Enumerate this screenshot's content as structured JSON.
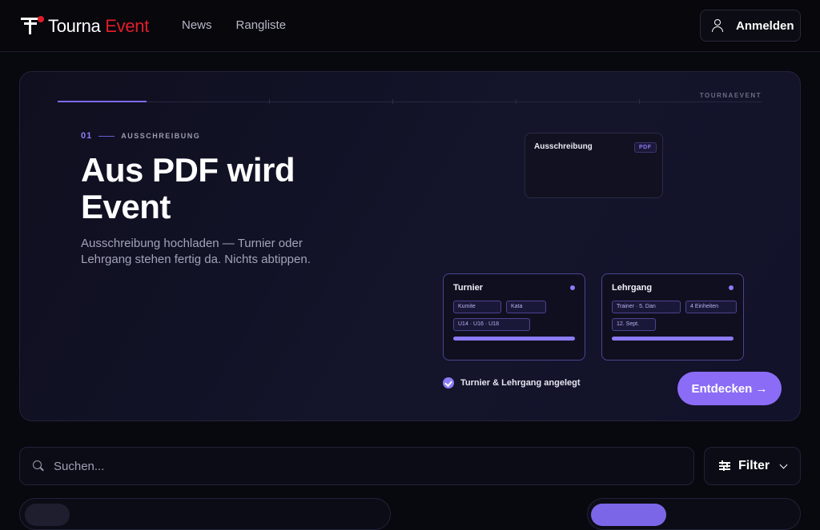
{
  "brand": {
    "name_part1": "Tourna",
    "name_part2": "Event",
    "small_label": "TOURNAEVENT"
  },
  "nav": {
    "items": [
      "News",
      "Rangliste"
    ]
  },
  "header": {
    "login_label": "Anmelden"
  },
  "hero": {
    "step_number": "01",
    "step_label": "AUSSCHREIBUNG",
    "title": "Aus PDF wird Event",
    "subtitle": "Ausschreibung hochladen — Turnier oder Lehrgang stehen fertig da. Nichts abtippen.",
    "pdf_card": {
      "title": "Ausschreibung",
      "badge": "PDF"
    },
    "cards": [
      {
        "title": "Turnier",
        "chips": [
          "Kumite",
          "Kata",
          "U14 · U16 · U18"
        ]
      },
      {
        "title": "Lehrgang",
        "chips": [
          "Trainer · 5. Dan",
          "4 Einheiten",
          "12. Sept."
        ]
      }
    ],
    "check_label": "Turnier & Lehrgang angelegt",
    "cta_label": "Entdecken →"
  },
  "search": {
    "placeholder": "Suchen..."
  },
  "filter": {
    "label": "Filter"
  },
  "colors": {
    "accent": "#8b6cf6",
    "brand_red": "#e11d2a",
    "background": "#08080f"
  }
}
